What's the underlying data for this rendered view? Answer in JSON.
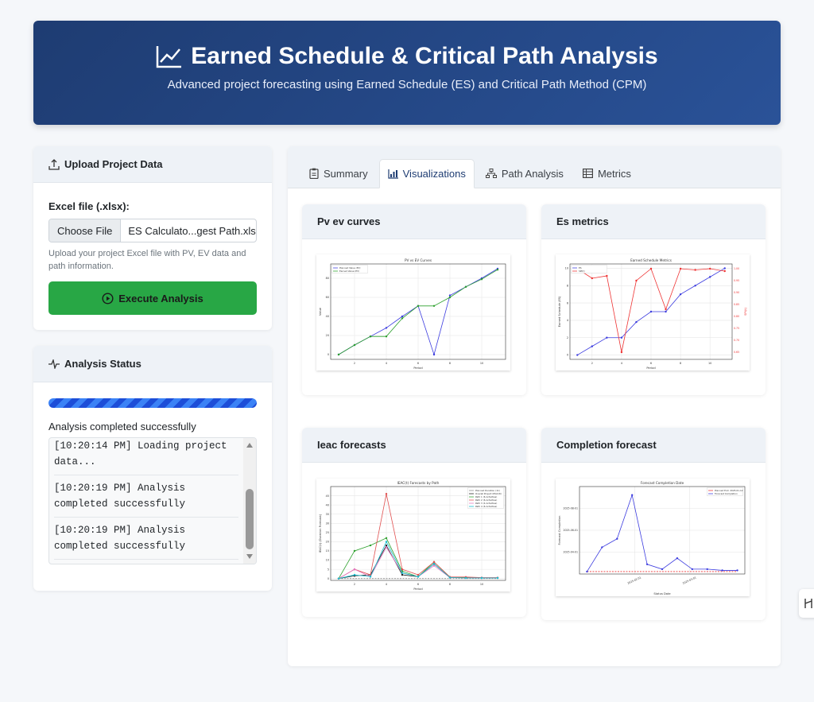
{
  "header": {
    "title": "Earned Schedule & Critical Path Analysis",
    "subtitle": "Advanced project forecasting using Earned Schedule (ES) and Critical Path Method (CPM)"
  },
  "upload": {
    "title": "Upload Project Data",
    "file_label": "Excel file (.xlsx):",
    "choose_button": "Choose File",
    "file_name": "ES Calculato...gest Path.xlsx",
    "help": "Upload your project Excel file with PV, EV data and path information.",
    "execute_label": "Execute Analysis"
  },
  "status": {
    "title": "Analysis Status",
    "progress_fraction": 1.0,
    "message": "Analysis completed successfully",
    "log": [
      "[10:20:14 PM] Loading project data...",
      "[10:20:19 PM] Analysis completed successfully",
      "[10:20:19 PM] Analysis completed successfully"
    ]
  },
  "tabs": [
    {
      "label": "Summary",
      "icon": "clipboard-icon",
      "active": false
    },
    {
      "label": "Visualizations",
      "icon": "bar-chart-icon",
      "active": true
    },
    {
      "label": "Path Analysis",
      "icon": "sitemap-icon",
      "active": false
    },
    {
      "label": "Metrics",
      "icon": "table-icon",
      "active": false
    }
  ],
  "cards": {
    "pv_ev": "Pv ev curves",
    "es_metrics": "Es metrics",
    "ieac": "Ieac forecasts",
    "completion": "Completion forecast"
  },
  "chart_data": [
    {
      "type": "line",
      "title": "PV vs EV Curves",
      "xlabel": "Period",
      "ylabel": "Value",
      "x": [
        1,
        2,
        3,
        4,
        5,
        6,
        7,
        8,
        9,
        10,
        11
      ],
      "xlim": [
        0.5,
        11.5
      ],
      "ylim": [
        -5,
        95
      ],
      "xticks": [
        2,
        4,
        6,
        8,
        10
      ],
      "yticks": [
        0,
        20,
        40,
        60,
        80
      ],
      "grid": true,
      "legend": "top-left",
      "series": [
        {
          "name": "Planned Value (PV)",
          "color": "#3b3bdf",
          "values": [
            0,
            10,
            19,
            28,
            40,
            51,
            0,
            62,
            71,
            80,
            90
          ]
        },
        {
          "name": "Earned Value (EV)",
          "color": "#2ca02c",
          "values": [
            0,
            10,
            19,
            19,
            38,
            51,
            51,
            60,
            71,
            79,
            89
          ]
        }
      ]
    },
    {
      "type": "line",
      "title": "Earned Schedule Metrics",
      "xlabel": "Period",
      "ylabel": "Earned Schedule (ES)",
      "y2label": "SPI(t)",
      "x": [
        1,
        2,
        3,
        4,
        5,
        6,
        7,
        8,
        9,
        10,
        11
      ],
      "xlim": [
        0.5,
        11.5
      ],
      "ylim": [
        -0.5,
        10.5
      ],
      "y2lim": [
        0.62,
        1.02
      ],
      "xticks": [
        2,
        4,
        6,
        8,
        10
      ],
      "yticks": [
        0,
        2,
        4,
        6,
        8,
        10
      ],
      "y2ticks": [
        0.65,
        0.7,
        0.75,
        0.8,
        0.85,
        0.9,
        0.95,
        1.0
      ],
      "grid": true,
      "legend": "top-left",
      "series": [
        {
          "name": "ES",
          "color": "#3b3bdf",
          "axis": "left",
          "values": [
            0,
            1,
            2,
            2,
            3.8,
            5,
            5,
            7,
            8,
            9,
            10
          ]
        },
        {
          "name": "SPI(t)",
          "color": "#e33",
          "axis": "right",
          "values": [
            1.0,
            0.96,
            0.97,
            0.65,
            0.95,
            1.0,
            0.83,
            1.0,
            0.995,
            1.0,
            0.99
          ]
        }
      ]
    },
    {
      "type": "line",
      "title": "IEAC(t) Forecasts by Path",
      "xlabel": "Period",
      "ylabel": "IEAC(t) (Duration Forecast)",
      "x": [
        1,
        2,
        3,
        4,
        5,
        6,
        7,
        8,
        9,
        10,
        11
      ],
      "xlim": [
        0.5,
        11.5
      ],
      "ylim": [
        -1,
        50
      ],
      "xticks": [
        2,
        4,
        6,
        8,
        10
      ],
      "yticks": [
        0,
        5,
        10,
        15,
        20,
        25,
        30,
        35,
        40,
        45
      ],
      "grid": true,
      "legend": "top-right",
      "series": [
        {
          "name": "Planned Duration (11)",
          "color": "#888888",
          "dash": true,
          "values": [
            0,
            0,
            0,
            0,
            0,
            0,
            0,
            0,
            0,
            0,
            0
          ]
        },
        {
          "name": "Overall Project (IEAC(t))",
          "color": "#1f1f1f",
          "values": [
            0,
            1.5,
            2,
            18,
            2,
            1,
            8,
            0.5,
            0.5,
            0.3,
            0.3
          ]
        },
        {
          "name": "Path 1 (6 Activities)",
          "color": "#2ca02c",
          "values": [
            0,
            15,
            18,
            22,
            4,
            1,
            9,
            0.8,
            0.5,
            0.3,
            0.3
          ]
        },
        {
          "name": "Path 2 (6 Activities)",
          "color": "#e05050",
          "values": [
            0,
            5,
            2,
            46,
            5,
            2,
            9,
            0.8,
            0.8,
            0.5,
            0.5
          ]
        },
        {
          "name": "Path 3 (4 Activities)",
          "color": "#e377c2",
          "values": [
            0,
            5,
            1,
            17,
            3,
            1,
            7,
            0.5,
            0.3,
            0.3,
            0.3
          ]
        },
        {
          "name": "Path 4 (6 Activities)",
          "color": "#17becf",
          "values": [
            0,
            2,
            1,
            20,
            3,
            1,
            8,
            0.5,
            0.3,
            0.3,
            0.3
          ]
        }
      ]
    },
    {
      "type": "line",
      "title": "Forecast Completion Date",
      "xlabel": "Status Date",
      "ylabel": "Forecast Completion",
      "x": [
        1,
        2,
        3,
        4,
        5,
        6,
        7,
        8,
        9,
        10,
        11
      ],
      "xlim": [
        0.5,
        11.5
      ],
      "ylim": [
        -2,
        70
      ],
      "xticks_labels": [
        "2025-02-01",
        "2025-03-01"
      ],
      "yticks_labels": [
        "2025-04-01",
        "2025-06-01",
        "2025-08-01"
      ],
      "grid": true,
      "legend": "top-right",
      "series": [
        {
          "name": "Planned End: 2025-01-12",
          "color": "#e33",
          "dash": true,
          "values": [
            0,
            0,
            0,
            0,
            0,
            0,
            0,
            0,
            0,
            0,
            0
          ]
        },
        {
          "name": "Forecast Completion",
          "color": "#3b3bdf",
          "values": [
            0,
            20,
            27,
            63,
            6,
            2,
            11,
            2,
            2,
            1,
            1
          ]
        }
      ]
    }
  ]
}
